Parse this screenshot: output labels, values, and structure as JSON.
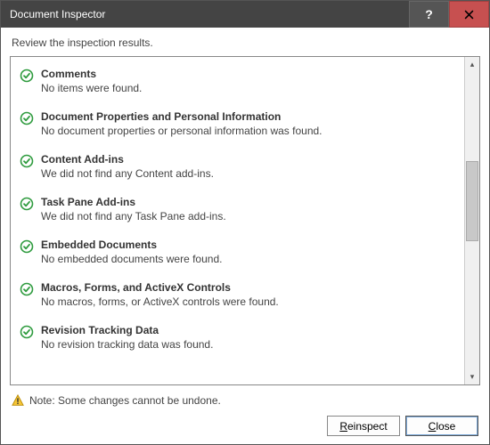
{
  "title": "Document Inspector",
  "subheader": "Review the inspection results.",
  "items": [
    {
      "title": "Comments",
      "desc": "No items were found."
    },
    {
      "title": "Document Properties and Personal Information",
      "desc": "No document properties or personal information was found."
    },
    {
      "title": "Content Add-ins",
      "desc": "We did not find any Content add-ins."
    },
    {
      "title": "Task Pane Add-ins",
      "desc": "We did not find any Task Pane add-ins."
    },
    {
      "title": "Embedded Documents",
      "desc": "No embedded documents were found."
    },
    {
      "title": "Macros, Forms, and ActiveX Controls",
      "desc": "No macros, forms, or ActiveX controls were found."
    },
    {
      "title": "Revision Tracking Data",
      "desc": "No revision tracking data was found."
    }
  ],
  "note": "Note: Some changes cannot be undone.",
  "buttons": {
    "reinspect": "Reinspect",
    "close": "Close"
  }
}
